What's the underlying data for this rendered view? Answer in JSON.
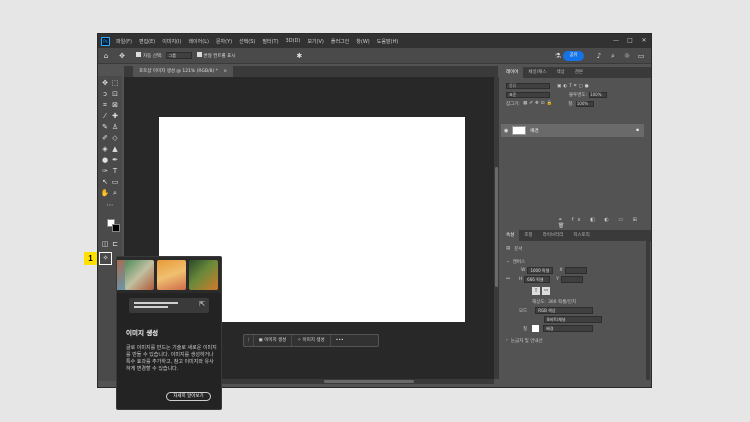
{
  "app": {
    "menu": [
      "파일(F)",
      "편집(E)",
      "이미지(I)",
      "레이어(L)",
      "문자(Y)",
      "선택(S)",
      "필터(T)",
      "3D(D)",
      "보기(V)",
      "플러그인",
      "창(W)",
      "도움말(H)"
    ],
    "window_controls": [
      "—",
      "□",
      "✕"
    ]
  },
  "options_bar": {
    "auto_select_label": "자동 선택:",
    "auto_select_value": "그룹",
    "transform_label": "변형 컨트롤 표시",
    "share_label": "공유"
  },
  "document_tab": {
    "title": "포토샵 이미지 생성 @ 121% (RGB/8) *",
    "close": "×"
  },
  "contextual_bar": {
    "generate_image": "이미지 생성",
    "generate_image_2": "이미지 생성",
    "more": "•••"
  },
  "layers_panel": {
    "tabs": [
      "레이어",
      "채널/패스",
      "색상",
      "견본"
    ],
    "search_placeholder": "종류",
    "blend_mode": "표준",
    "opacity_label": "불투명도:",
    "opacity_value": "100%",
    "lock_label": "잠그기:",
    "fill_label": "칠:",
    "fill_value": "100%",
    "layer_name": "배경"
  },
  "properties_panel": {
    "tabs": [
      "속성",
      "조정",
      "라이브러리",
      "히스토리"
    ],
    "doc_label": "문서",
    "canvas_section": "캔버스",
    "width_label": "W",
    "width_value": "1000 픽셀",
    "height_label": "H",
    "height_value": "666 픽셀",
    "x_label": "X",
    "y_label": "Y",
    "resolution_label": "해상도:",
    "resolution_value": "300 픽셀/인치",
    "mode_label": "모드",
    "mode_value": "RGB 색상",
    "depth_value": "8비트/채널",
    "fill_label": "칠",
    "fill_value": "배경",
    "guides_label": "눈금자 및 안내선"
  },
  "step_badge": "1",
  "popup": {
    "title": "이미지 생성",
    "description": "글로 이미지를 만드는 기술로 새로운 이미지를 만들 수 있습니다. 이미지를 생성하거나 특수 효과를 추가하고, 참고 이미지와 유사하게 변경할 수 있습니다.",
    "learn_more": "자세히 알아보기"
  },
  "colors": {
    "accent": "#1473e6",
    "badge": "#ffe100",
    "canvas": "#ffffff"
  }
}
